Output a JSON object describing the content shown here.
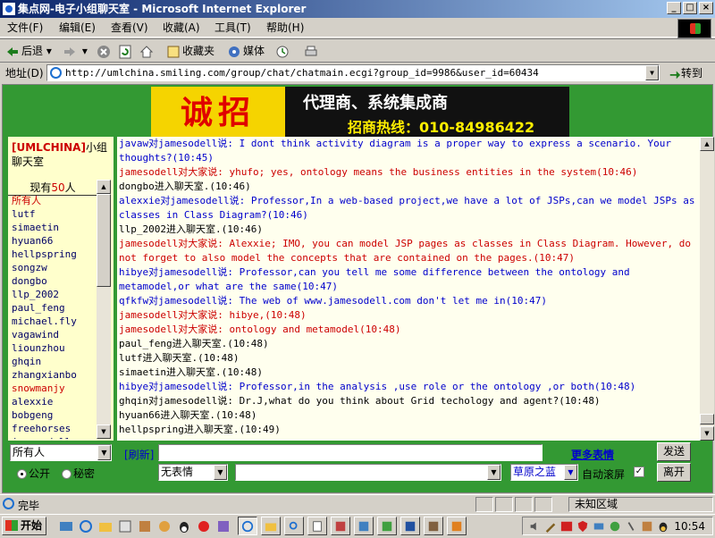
{
  "window": {
    "title": "集点网-电子小组聊天室 - Microsoft Internet Explorer",
    "controls": {
      "minimize": "_",
      "maximize": "□",
      "close": "×"
    }
  },
  "menu": [
    "文件(F)",
    "编辑(E)",
    "查看(V)",
    "收藏(A)",
    "工具(T)",
    "帮助(H)"
  ],
  "toolbar": {
    "back": "后退",
    "favorites": "收藏夹",
    "media": "媒体"
  },
  "address": {
    "label": "地址(D)",
    "url": "http://umlchina.smiling.com/group/chat/chatmain.ecgi?group_id=9986&user_id=60434",
    "go": "转到"
  },
  "banner": {
    "left": "诚招",
    "line1": "代理商、系统集成商",
    "line2": "招商热线：010-84986422"
  },
  "sidebar": {
    "group_tag": "UMLCHINA",
    "group_suffix": "小组聊天室",
    "online_prefix": "现有",
    "online_count": "50",
    "online_suffix": "人",
    "users": [
      "所有人",
      "lutf",
      "simaetin",
      "hyuan66",
      "hellpspring",
      "songzw",
      "dongbo",
      "llp_2002",
      "paul_feng",
      "michael.fly",
      "vagawind",
      "liounzhou",
      "ghqin",
      "zhangxianbo",
      "snowmanjy",
      "alexxie",
      "bobgeng",
      "freehorses",
      "jamesodell"
    ]
  },
  "chat": {
    "messages": [
      {
        "color": "blue",
        "text": "javaw对jamesodell说: I dont think activity diagram is a proper way to express a scenario. Your thoughts?(10:45)"
      },
      {
        "color": "red",
        "text": "jamesodell对大家说: yhufo; yes, ontology means the business entities in the system(10:46)"
      },
      {
        "color": "black",
        "text": "dongbo进入聊天室.(10:46)"
      },
      {
        "color": "blue",
        "text": "alexxie对jamesodell说: Professor,In a web-based project,we have a lot of JSPs,can we model JSPs as classes in Class Diagram?(10:46)"
      },
      {
        "color": "black",
        "text": "llp_2002进入聊天室.(10:46)"
      },
      {
        "color": "red",
        "text": "jamesodell对大家说: Alexxie; IMO, you can model JSP pages as classes in Class Diagram. However, do not forget to also model the concepts that are contained on the pages.(10:47)"
      },
      {
        "color": "blue",
        "text": "hibye对jamesodell说: Professor,can you tell me some difference between the ontology and metamodel,or what are the same(10:47)"
      },
      {
        "color": "blue",
        "text": "qfkfw对jamesodell说: The web of www.jamesodell.com don't let me in(10:47)"
      },
      {
        "color": "red",
        "text": "jamesodell对大家说: hibye,(10:48)"
      },
      {
        "color": "red",
        "text": "jamesodell对大家说: ontology and metamodel(10:48)"
      },
      {
        "color": "black",
        "text": "paul_feng进入聊天室.(10:48)"
      },
      {
        "color": "black",
        "text": "lutf进入聊天室.(10:48)"
      },
      {
        "color": "black",
        "text": "simaetin进入聊天室.(10:48)"
      },
      {
        "color": "blue",
        "text": "hibye对jamesodell说: Professor,in the analysis ,use role or the ontology ,or both(10:48)"
      },
      {
        "color": "black",
        "text": "ghqin对jamesodell说: Dr.J,what do you think about Grid techology and agent?(10:48)"
      },
      {
        "color": "black",
        "text": "hyuan66进入聊天室.(10:48)"
      },
      {
        "color": "black",
        "text": "hellpspring进入聊天室.(10:49)"
      }
    ]
  },
  "form": {
    "target_select": "所有人",
    "refresh": "[刷新]",
    "more_emotes": "更多表情",
    "send": "发送",
    "public": "公开",
    "private": "秘密",
    "emote_select": "无表情",
    "action_select": "",
    "color_select": "草原之蓝",
    "autoscroll": "自动滚屏",
    "leave": "离开"
  },
  "status": {
    "text": "完毕",
    "zone": "未知区域"
  },
  "taskbar": {
    "start": "开始",
    "clock": "10:54"
  }
}
